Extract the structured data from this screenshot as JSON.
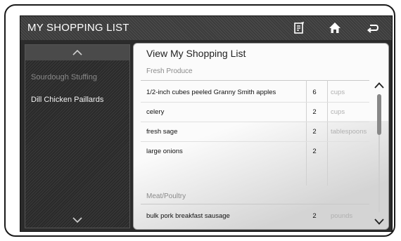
{
  "header": {
    "title": "MY SHOPPING LIST",
    "icons": [
      "list-edit-icon",
      "home-icon",
      "back-icon"
    ]
  },
  "sidebar": {
    "items": [
      {
        "label": "Sourdough Stuffing",
        "state": "dim"
      },
      {
        "label": "Dill Chicken Paillards",
        "state": "active"
      }
    ]
  },
  "panel": {
    "title": "View My Shopping List",
    "sections": [
      {
        "heading": "Fresh Produce",
        "rows": [
          {
            "name": "1/2-inch cubes peeled Granny Smith apples",
            "qty": "6",
            "unit": "cups"
          },
          {
            "name": "celery",
            "qty": "2",
            "unit": "cups"
          },
          {
            "name": "fresh sage",
            "qty": "2",
            "unit": "tablespoons"
          },
          {
            "name": "large onions",
            "qty": "2",
            "unit": ""
          }
        ]
      },
      {
        "heading": "Meat/Poultry",
        "rows": [
          {
            "name": "bulk pork breakfast sausage",
            "qty": "2",
            "unit": "pounds"
          }
        ]
      }
    ]
  },
  "colors": {
    "title_bar": "#444444",
    "panel_bg": "#fbfbfb",
    "unit_text": "#b0b0b0"
  }
}
